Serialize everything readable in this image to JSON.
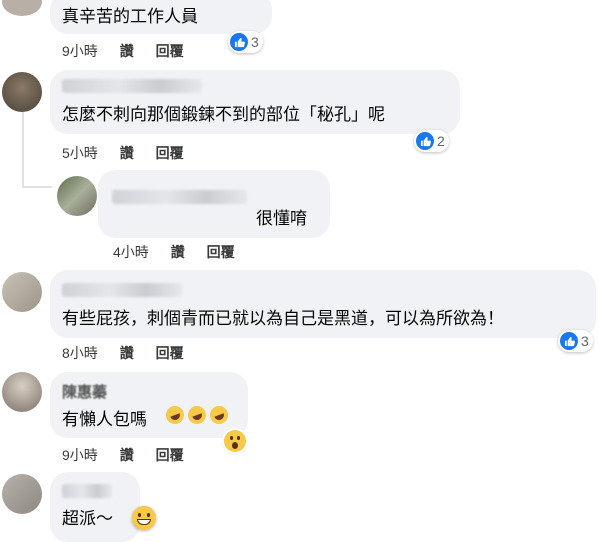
{
  "comments": [
    {
      "text": "真辛苦的工作人員",
      "time": "9小時",
      "like": "讚",
      "reply": "回覆",
      "reactions": "3"
    },
    {
      "text": "怎麼不刺向那個鍛鍊不到的部位「秘孔」呢",
      "time": "5小時",
      "like": "讚",
      "reply": "回覆",
      "reactions": "2"
    },
    {
      "text": "很懂唷",
      "time": "4小時",
      "like": "讚",
      "reply": "回覆"
    },
    {
      "text": "有些屁孩，刺個青而已就以為自己是黑道，可以為所欲為！",
      "time": "8小時",
      "like": "讚",
      "reply": "回覆",
      "reactions": "3"
    },
    {
      "name": "陳惠蓁",
      "text": "有懶人包嗎",
      "time": "9小時",
      "like": "讚",
      "reply": "回覆"
    },
    {
      "text": "超派～"
    }
  ],
  "colors": {
    "bubble": "#f0f2f5",
    "like_blue": "#1877f2",
    "emoji_yellow": "#f7c948"
  },
  "icons": [
    "like-icon",
    "rofl-emoji",
    "wow-emoji",
    "grin-emoji"
  ]
}
